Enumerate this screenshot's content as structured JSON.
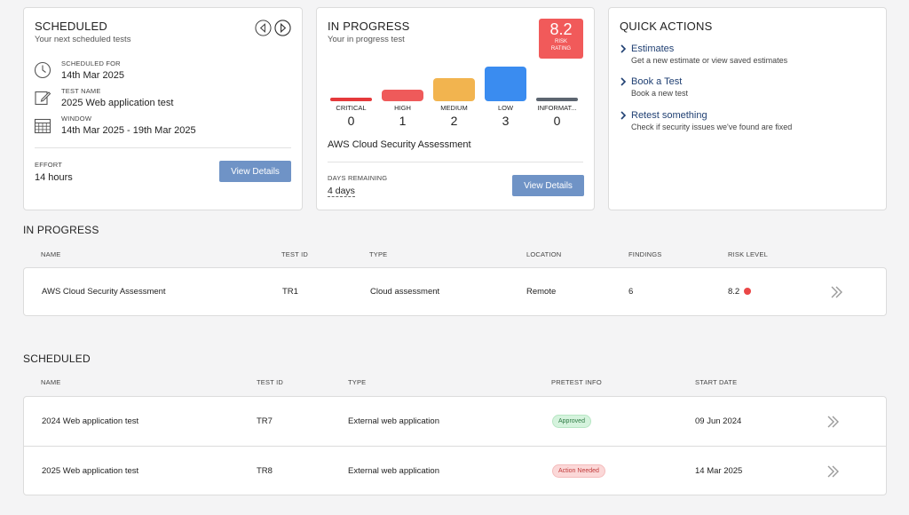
{
  "scheduled_card": {
    "title": "SCHEDULED",
    "subtitle": "Your next scheduled tests",
    "scheduled_for_label": "SCHEDULED FOR",
    "scheduled_for_value": "14th Mar 2025",
    "test_name_label": "TEST NAME",
    "test_name_value": "2025 Web application test",
    "window_label": "WINDOW",
    "window_value": "14th Mar 2025 - 19th Mar 2025",
    "effort_label": "EFFORT",
    "effort_value": "14 hours",
    "button_label": "View Details"
  },
  "progress_card": {
    "title": "IN PROGRESS",
    "subtitle": "Your in progress test",
    "risk_score": "8.2",
    "risk_label_1": "RISK",
    "risk_label_2": "RATING",
    "findings": [
      {
        "label": "CRITICAL",
        "count": "0",
        "color": "#e5393b",
        "level": 0
      },
      {
        "label": "HIGH",
        "count": "1",
        "color": "#ef5a5a",
        "level": 1
      },
      {
        "label": "MEDIUM",
        "count": "2",
        "color": "#f2b44f",
        "level": 2
      },
      {
        "label": "LOW",
        "count": "3",
        "color": "#3a8cf0",
        "level": 3
      },
      {
        "label": "INFORMAT...",
        "count": "0",
        "color": "#5c6570",
        "level": 0
      }
    ],
    "test_title": "AWS Cloud Security Assessment",
    "days_label": "DAYS REMAINING",
    "days_value": "4 days",
    "button_label": "View Details"
  },
  "quick_actions": {
    "title": "QUICK ACTIONS",
    "items": [
      {
        "label": "Estimates",
        "desc": "Get a new estimate or view saved estimates"
      },
      {
        "label": "Book a Test",
        "desc": "Book a new test"
      },
      {
        "label": "Retest something",
        "desc": "Check if security issues we've found are fixed"
      }
    ]
  },
  "in_progress_table": {
    "title": "IN PROGRESS",
    "headers": [
      "NAME",
      "TEST ID",
      "TYPE",
      "LOCATION",
      "FINDINGS",
      "RISK LEVEL"
    ],
    "rows": [
      {
        "name": "AWS Cloud Security Assessment",
        "test_id": "TR1",
        "type": "Cloud assessment",
        "location": "Remote",
        "findings": "6",
        "risk": "8.2",
        "risk_color": "#ea4747"
      }
    ]
  },
  "scheduled_table": {
    "title": "SCHEDULED",
    "headers": [
      "NAME",
      "TEST ID",
      "TYPE",
      "PRETEST INFO",
      "START DATE"
    ],
    "rows": [
      {
        "name": "2024 Web application test",
        "test_id": "TR7",
        "type": "External web application",
        "pretest": "Approved",
        "start_date": "09 Jun 2024"
      },
      {
        "name": "2025 Web application test",
        "test_id": "TR8",
        "type": "External web application",
        "pretest": "Action Needed",
        "start_date": "14 Mar 2025"
      }
    ]
  },
  "icons": {
    "scheduled_for": "clock-icon",
    "test_name": "edit-icon",
    "window": "calendar-icon",
    "prev": "chevron-left-icon",
    "next": "chevron-right-icon",
    "row_action": "double-chevron-right-icon"
  }
}
